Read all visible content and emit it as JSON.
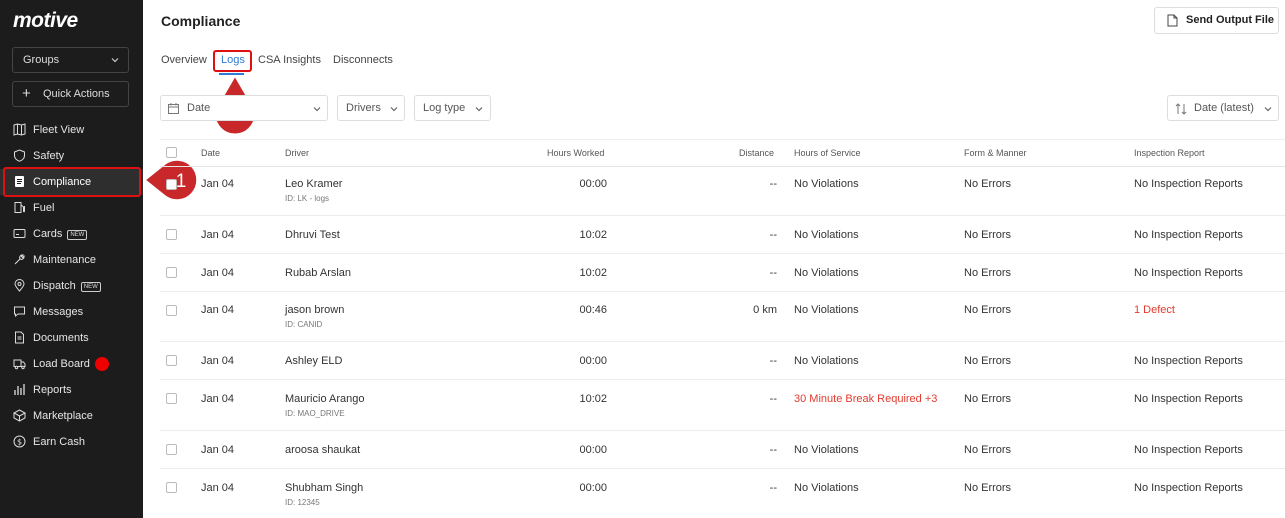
{
  "sidebar": {
    "logo": "motive",
    "groups_label": "Groups",
    "quick_actions_label": "Quick Actions",
    "items": [
      {
        "label": "Fleet View",
        "icon": "map-icon"
      },
      {
        "label": "Safety",
        "icon": "shield-icon"
      },
      {
        "label": "Compliance",
        "icon": "document-icon"
      },
      {
        "label": "Fuel",
        "icon": "fuel-icon"
      },
      {
        "label": "Cards",
        "icon": "card-icon",
        "badge": "NEW"
      },
      {
        "label": "Maintenance",
        "icon": "wrench-icon"
      },
      {
        "label": "Dispatch",
        "icon": "location-pin-icon",
        "badge": "NEW"
      },
      {
        "label": "Messages",
        "icon": "message-icon"
      },
      {
        "label": "Documents",
        "icon": "file-icon"
      },
      {
        "label": "Load Board",
        "icon": "truck-icon"
      },
      {
        "label": "Reports",
        "icon": "bar-chart-icon"
      },
      {
        "label": "Marketplace",
        "icon": "cube-icon"
      },
      {
        "label": "Earn Cash",
        "icon": "dollar-icon"
      }
    ]
  },
  "callouts": {
    "first": "1",
    "second": "2"
  },
  "header": {
    "title": "Compliance",
    "send_output_label": "Send Output File"
  },
  "tabs": [
    "Overview",
    "Logs",
    "CSA Insights",
    "Disconnects"
  ],
  "filters": {
    "date": "Date",
    "drivers": "Drivers",
    "log_type": "Log type",
    "sort": "Date (latest)"
  },
  "table": {
    "columns": [
      "Date",
      "Driver",
      "Hours Worked",
      "Distance",
      "Hours of Service",
      "Form & Manner",
      "Inspection Report"
    ],
    "rows": [
      {
        "date": "Jan 04",
        "driver": "Leo Kramer",
        "driver_id": "ID: LK - logs",
        "hours": "00:00",
        "distance": "--",
        "hos": "No Violations",
        "form": "No Errors",
        "inspection": "No Inspection Reports"
      },
      {
        "date": "Jan 04",
        "driver": "Dhruvi Test",
        "driver_id": "",
        "hours": "10:02",
        "distance": "--",
        "hos": "No Violations",
        "form": "No Errors",
        "inspection": "No Inspection Reports"
      },
      {
        "date": "Jan 04",
        "driver": "Rubab Arslan",
        "driver_id": "",
        "hours": "10:02",
        "distance": "--",
        "hos": "No Violations",
        "form": "No Errors",
        "inspection": "No Inspection Reports"
      },
      {
        "date": "Jan 04",
        "driver": "jason brown",
        "driver_id": "ID: CANID",
        "hours": "00:46",
        "distance": "0 km",
        "hos": "No Violations",
        "form": "No Errors",
        "inspection": "1 Defect"
      },
      {
        "date": "Jan 04",
        "driver": "Ashley ELD",
        "driver_id": "",
        "hours": "00:00",
        "distance": "--",
        "hos": "No Violations",
        "form": "No Errors",
        "inspection": "No Inspection Reports"
      },
      {
        "date": "Jan 04",
        "driver": "Mauricio Arango",
        "driver_id": "ID: MAO_DRIVE",
        "hours": "10:02",
        "distance": "--",
        "hos": "30 Minute Break Required +3",
        "form": "No Errors",
        "inspection": "No Inspection Reports"
      },
      {
        "date": "Jan 04",
        "driver": "aroosa shaukat",
        "driver_id": "",
        "hours": "00:00",
        "distance": "--",
        "hos": "No Violations",
        "form": "No Errors",
        "inspection": "No Inspection Reports"
      },
      {
        "date": "Jan 04",
        "driver": "Shubham Singh",
        "driver_id": "ID: 12345",
        "hours": "00:00",
        "distance": "--",
        "hos": "No Violations",
        "form": "No Errors",
        "inspection": "No Inspection Reports"
      }
    ]
  },
  "colors": {
    "accent": "#2e7bd6",
    "highlight": "#d11111",
    "alert": "#e23b2e",
    "sidebar_bg": "#1c1c1c"
  }
}
